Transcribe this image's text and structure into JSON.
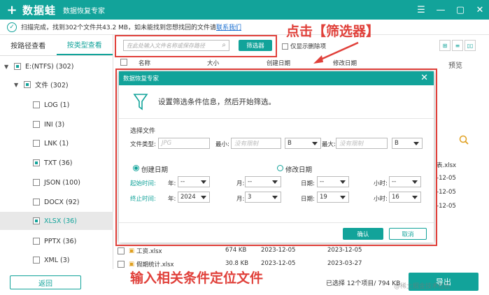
{
  "titlebar": {
    "logo_glyph": "+",
    "app_name": "数据蛙",
    "subtitle": "数据恢复专家",
    "controls": [
      "☰",
      "—",
      "▢",
      "✕"
    ]
  },
  "status": {
    "message": "扫描完成，找到302个文件共43.2 MB，如未能找到您想找回的文件请",
    "link": "联系我们"
  },
  "left_tabs": [
    "按路径查看",
    "按类型查看"
  ],
  "tree": [
    {
      "label": "E:(NTFS) (302)",
      "level": 0
    },
    {
      "label": "文件 (302)",
      "level": 1
    },
    {
      "label": "LOG (1)",
      "level": 2
    },
    {
      "label": "INI (3)",
      "level": 2
    },
    {
      "label": "LNK (1)",
      "level": 2
    },
    {
      "label": "TXT (36)",
      "level": 2
    },
    {
      "label": "JSON (100)",
      "level": 2
    },
    {
      "label": "DOCX (92)",
      "level": 2
    },
    {
      "label": "XLSX (36)",
      "level": 2
    },
    {
      "label": "PPTX (36)",
      "level": 2
    },
    {
      "label": "XML (3)",
      "level": 2
    }
  ],
  "toolbar": {
    "search_placeholder": "在此处输入文件名称或保存路径",
    "filter_button": "筛选器",
    "show_deleted": "仅显示删除项",
    "view_icons": [
      "⊞",
      "≡",
      "▯▯"
    ]
  },
  "annotations": {
    "top": "点击【筛选器】",
    "bottom": "输入相关条件定位文件"
  },
  "table_header": [
    "名称",
    "大小",
    "创建日期",
    "修改日期"
  ],
  "preview_label": "预览",
  "bg_rows": [
    {
      "name": "工资.xlsx",
      "size": "674 KB",
      "created": "2023-12-05",
      "modified": "2023-12-05"
    },
    {
      "name": "假期统计.xlsx",
      "size": "30.8 KB",
      "created": "2023-12-05",
      "modified": "2023-03-27"
    }
  ],
  "bg_side": [
    "表.xlsx",
    "-12-05",
    "-12-05",
    "-12-05"
  ],
  "modal": {
    "title": "数据恢复专家",
    "heading": "设置筛选条件信息，然后开始筛选。",
    "select_file": "选择文件",
    "file_type_label": "文件类型:",
    "file_type_placeholder": "JPG",
    "min_label": "最小:",
    "min_placeholder": "没有限制",
    "min_unit": "B",
    "max_label": "最大:",
    "max_placeholder": "没有限制",
    "max_unit": "B",
    "created_date": "创建日期",
    "modified_date": "修改日期",
    "start_label": "起始时间:",
    "end_label": "终止时间:",
    "year_label": "年:",
    "month_label": "月:",
    "day_label": "日期:",
    "hour_label": "小时:",
    "start": {
      "year": "--",
      "month": "--",
      "day": "--",
      "hour": "--"
    },
    "end": {
      "year": "2024",
      "month": "3",
      "day": "19",
      "hour": "16"
    },
    "ok": "确认",
    "cancel": "取消"
  },
  "bottom": {
    "back": "返回",
    "summary": "已选择 12个项目/ 794 KB",
    "export": "导出",
    "watermark": "@稀土掘金技术社区"
  },
  "colors": {
    "accent": "#12a39a",
    "annotation": "#e0403a",
    "link": "#1a6fd1"
  }
}
